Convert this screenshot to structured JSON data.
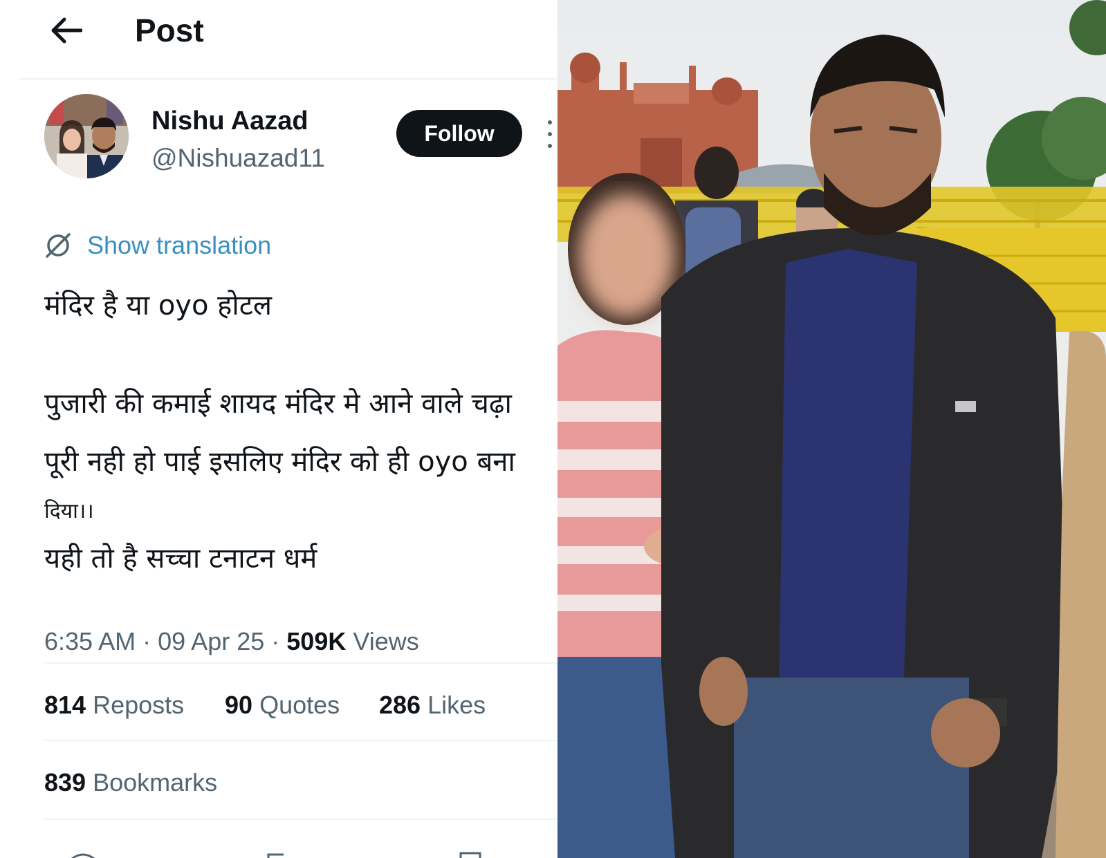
{
  "header": {
    "title": "Post"
  },
  "author": {
    "display_name": "Nishu Aazad",
    "handle": "@Nishuazad11",
    "follow_label": "Follow"
  },
  "translation": {
    "label": "Show translation"
  },
  "tweet": {
    "line1": "मंदिर है या oyo होटल",
    "line2": "पुजारी की कमाई शायद मंदिर मे आने वाले चढ़ा",
    "line3": "पूरी नही हो पाई इसलिए मंदिर को ही oyo बना",
    "line4": "दिया।।",
    "line5": "यही तो है सच्चा टनाटन धर्म"
  },
  "meta": {
    "time": "6:35 AM",
    "date": "09 Apr 25",
    "views_count": "509K",
    "views_label": "Views",
    "separator": "·"
  },
  "stats": {
    "reposts_count": "814",
    "reposts_label": "Reposts",
    "quotes_count": "90",
    "quotes_label": "Quotes",
    "likes_count": "286",
    "likes_label": "Likes",
    "bookmarks_count": "839",
    "bookmarks_label": "Bookmarks"
  },
  "colors": {
    "text_primary": "#0f1419",
    "text_secondary": "#536471",
    "link": "#3a8fc0",
    "divider": "#eff3f4",
    "fort_red": "#b9624a",
    "barrier_yellow": "#e8c81e",
    "jacket": "#2a2a2c",
    "polo": "#2b3470"
  },
  "icons": {
    "back": "arrow-left-icon",
    "more": "more-vertical-icon",
    "translate": "translate-icon"
  }
}
